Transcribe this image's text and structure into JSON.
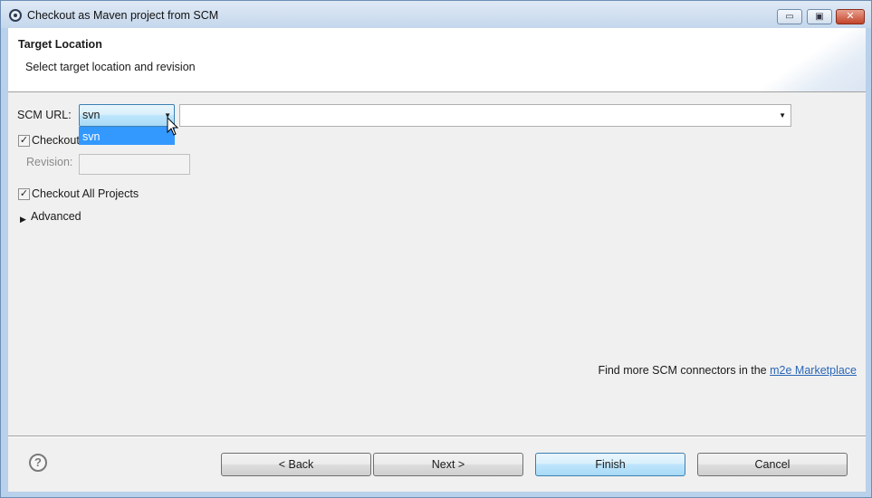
{
  "window": {
    "title": "Checkout as Maven project from SCM",
    "controls": {
      "minimize": "▭",
      "maximize": "▣",
      "close": "✕"
    }
  },
  "header": {
    "title": "Target Location",
    "subtitle": "Select target location and revision"
  },
  "form": {
    "scm_url_label": "SCM URL:",
    "scm_type_selected": "svn",
    "scm_type_options": [
      "svn"
    ],
    "url_value": "",
    "checkout_head_label": "Checkout",
    "checkout_head_checked": true,
    "revision_label": "Revision:",
    "revision_value": "",
    "checkout_all_label": "Checkout All Projects",
    "checkout_all_checked": true,
    "advanced_label": "Advanced"
  },
  "marketplace": {
    "text": "Find more SCM connectors in the",
    "link": "m2e Marketplace"
  },
  "buttons": {
    "help": "?",
    "back": "< Back",
    "next": "Next >",
    "finish": "Finish",
    "cancel": "Cancel"
  },
  "glyphs": {
    "check": "✓",
    "dropdown_arrow": "▼",
    "expand_arrow": "▶"
  }
}
